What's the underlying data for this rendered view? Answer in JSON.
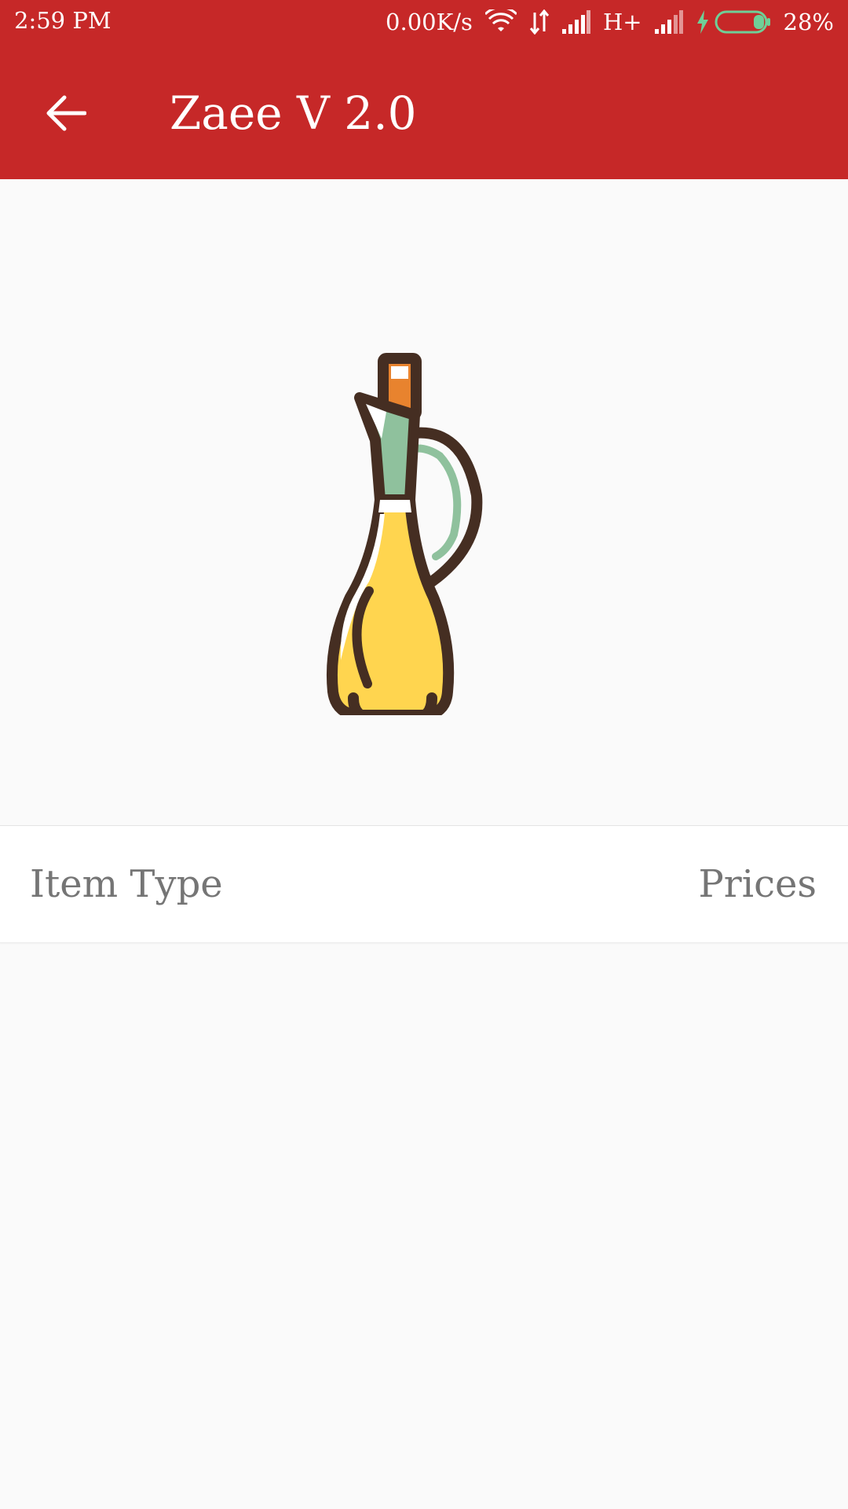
{
  "status_bar": {
    "time": "2:59 PM",
    "network_speed": "0.00K/s",
    "network_type": "H+",
    "battery_percent": "28%",
    "icons": [
      "wifi-icon",
      "data-transfer-icon",
      "signal-icon",
      "signal-icon",
      "charging-icon",
      "battery-icon"
    ]
  },
  "app_bar": {
    "title": "Zaee V 2.0",
    "back_icon": "arrow-left-icon"
  },
  "product": {
    "icon": "oil-bottle-icon"
  },
  "table": {
    "headers": {
      "item_type": "Item Type",
      "prices": "Prices"
    },
    "rows": []
  },
  "colors": {
    "primary": "#C62828",
    "background": "#FAFAFA",
    "header_text": "#757575",
    "bottle_outline": "#452E22",
    "bottle_oil": "#FFD54F",
    "bottle_glass": "#8FC19D",
    "bottle_cork": "#E8832E"
  }
}
